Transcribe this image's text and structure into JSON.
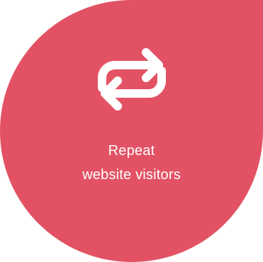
{
  "card": {
    "line1": "Repeat",
    "line2": "website visitors",
    "icon": "repeat-icon",
    "background_color": "#e25264",
    "text_color": "#ffffff"
  }
}
